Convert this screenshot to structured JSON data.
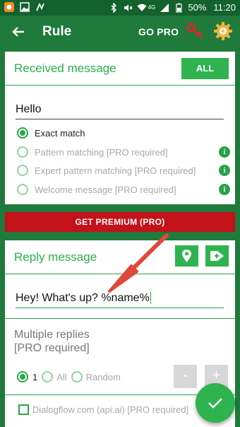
{
  "status_bar": {
    "battery_percent": "50%",
    "time": "11:20",
    "network": "4G"
  },
  "toolbar": {
    "title": "Rule",
    "go_pro_label": "GO PRO"
  },
  "received_card": {
    "title": "Received message",
    "all_label": "ALL",
    "input_value": "Hello",
    "options": [
      {
        "label": "Exact match",
        "selected": true,
        "enabled": true
      },
      {
        "label": "Pattern matching [PRO required]",
        "selected": false,
        "enabled": false
      },
      {
        "label": "Expert pattern matching [PRO required]",
        "selected": false,
        "enabled": false
      },
      {
        "label": "Welcome message [PRO required]",
        "selected": false,
        "enabled": false
      }
    ],
    "info_glyph": "i"
  },
  "premium_banner": {
    "label": "GET PREMIUM (PRO)"
  },
  "reply_card": {
    "title": "Reply message",
    "input_value": "Hey! What's up? %name%",
    "multiple_title_line1": "Multiple replies",
    "multiple_title_line2": "[PRO required]",
    "reply_options": [
      {
        "label": "1",
        "selected": true
      },
      {
        "label": "All",
        "selected": false
      },
      {
        "label": "Random",
        "selected": false
      }
    ],
    "minus_label": "-",
    "plus_label": "+",
    "dialogflow_label": "Dialogflow.com (api.ai) [PRO required]"
  },
  "icons": {
    "back": "arrow-left-icon",
    "key": "key-icon",
    "settings": "gear-icon",
    "location": "location-pin-icon",
    "tag": "add-tag-icon",
    "confirm": "checkmark-icon"
  },
  "colors": {
    "primary": "#1f7a3b",
    "accent": "#2fb34f",
    "premium": "#c4121b",
    "key": "#e0242a",
    "annotation_arrow": "#e2473b"
  }
}
